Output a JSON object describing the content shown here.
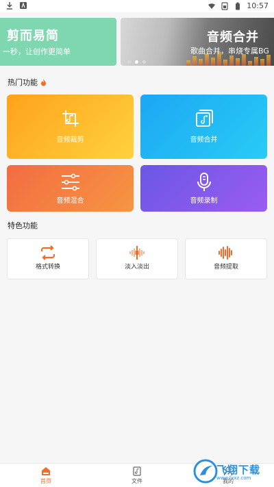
{
  "statusbar": {
    "time": "10:57",
    "icons": [
      "download-icon",
      "app-notification-icon",
      "wifi-icon",
      "sim-icon",
      "battery-icon"
    ]
  },
  "banner": {
    "left": {
      "title": "剪而易简",
      "subtitle": "一秒，让创作更简单"
    },
    "right": {
      "title": "音频合并",
      "subtitle": "歌曲合并，串烧专属BG"
    },
    "page_count": 3,
    "active_page": 1
  },
  "hot": {
    "title": "热门功能",
    "items": [
      {
        "label": "音频裁剪",
        "icon": "crop-icon"
      },
      {
        "label": "音频合并",
        "icon": "music-merge-icon"
      },
      {
        "label": "音频混合",
        "icon": "sliders-icon"
      },
      {
        "label": "音频录制",
        "icon": "microphone-icon"
      }
    ]
  },
  "features": {
    "title": "特色功能",
    "items": [
      {
        "label": "格式转换",
        "icon": "convert-icon"
      },
      {
        "label": "淡入淡出",
        "icon": "fade-icon"
      },
      {
        "label": "音频提取",
        "icon": "waveform-icon"
      }
    ]
  },
  "nav": {
    "items": [
      {
        "label": "首页",
        "icon": "home-icon",
        "active": true
      },
      {
        "label": "文件",
        "icon": "file-icon",
        "active": false
      },
      {
        "label": "我的",
        "icon": "profile-icon",
        "active": false
      }
    ]
  },
  "watermark": {
    "name": "飞翔下载",
    "url": "www.fxxz.com"
  },
  "colors": {
    "accent": "#f26c2a",
    "orange": "#ffa21a",
    "blue": "#1ca7f3",
    "coral": "#f26c43",
    "purple": "#7b58ea",
    "banner_green": "#7fd7b1"
  }
}
